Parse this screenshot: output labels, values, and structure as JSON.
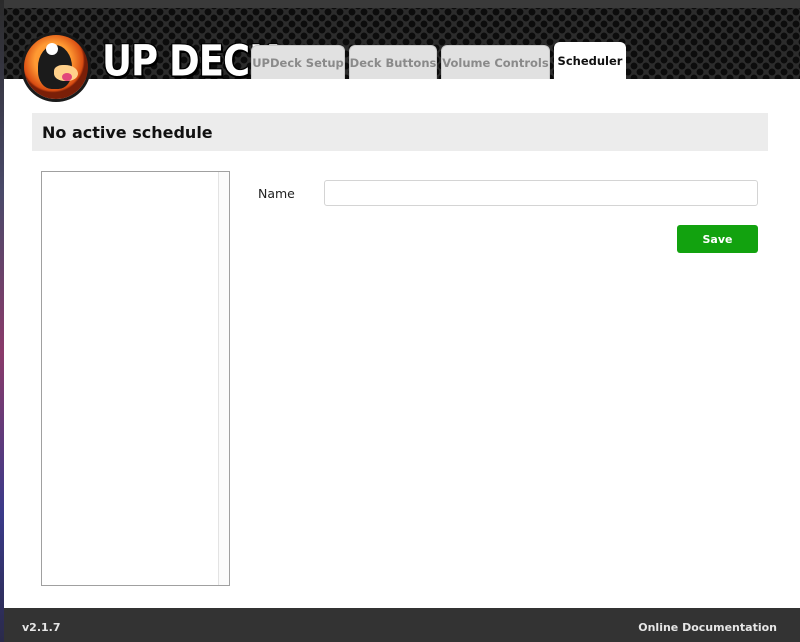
{
  "app": {
    "logo_text": "UP DECK"
  },
  "tabs": [
    {
      "label": "UPDeck Setup",
      "active": false
    },
    {
      "label": "Deck Buttons",
      "active": false
    },
    {
      "label": "Volume Controls",
      "active": false
    },
    {
      "label": "Scheduler",
      "active": true
    }
  ],
  "main": {
    "title": "No active schedule",
    "name_label": "Name",
    "name_value": "",
    "name_placeholder": "",
    "save_label": "Save"
  },
  "footer": {
    "version": "v2.1.7",
    "docs_link": "Online Documentation"
  },
  "colors": {
    "save_button": "#12a20f",
    "footer_bg": "#333333",
    "title_bar_bg": "#ececec"
  }
}
